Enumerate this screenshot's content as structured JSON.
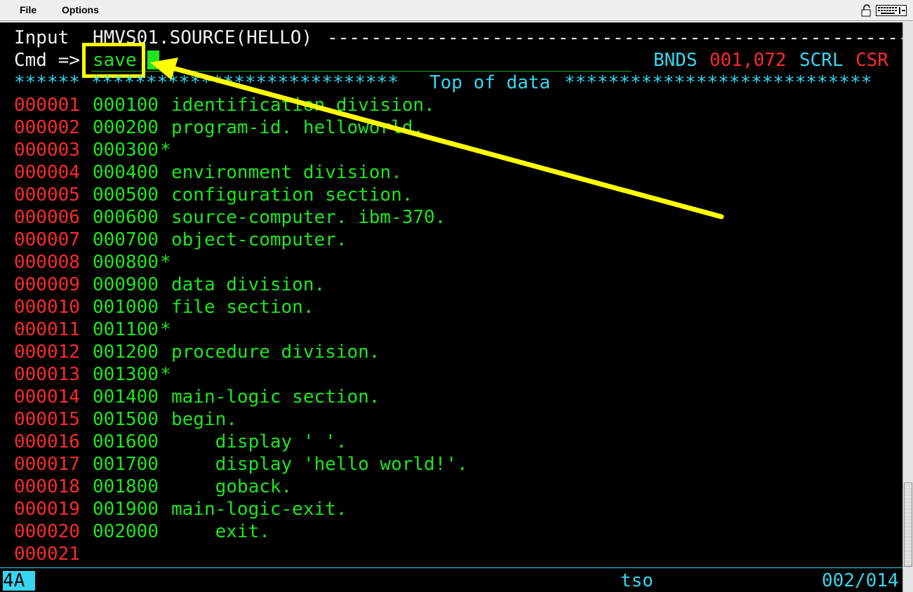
{
  "menubar": {
    "items": [
      {
        "label": "File"
      },
      {
        "label": "Options"
      }
    ],
    "tray_icons": [
      "lock-icon",
      "keyboard-icon"
    ]
  },
  "editor": {
    "header": {
      "mode": "Input",
      "dataset": "HMVS01.SOURCE(HELLO)",
      "rule": "------------------------------------------------------"
    },
    "command": {
      "prompt": "Cmd =>",
      "value": "save",
      "bnds_label": "BNDS",
      "bnds_value": "001,072",
      "scrl_label": "SCRL",
      "scrl_value": "CSR"
    },
    "top_of_data": {
      "left": "****** ****************************",
      "label": "Top of data",
      "right": "****************************"
    },
    "lines": [
      {
        "num": "000001",
        "seq": "000100",
        "text": "identification division."
      },
      {
        "num": "000002",
        "seq": "000200",
        "text": "program-id. helloworld."
      },
      {
        "num": "000003",
        "seq": "000300",
        "text": "*"
      },
      {
        "num": "000004",
        "seq": "000400",
        "text": "environment division."
      },
      {
        "num": "000005",
        "seq": "000500",
        "text": "configuration section."
      },
      {
        "num": "000006",
        "seq": "000600",
        "text": "source-computer. ibm-370."
      },
      {
        "num": "000007",
        "seq": "000700",
        "text": "object-computer."
      },
      {
        "num": "000008",
        "seq": "000800",
        "text": "*"
      },
      {
        "num": "000009",
        "seq": "000900",
        "text": "data division."
      },
      {
        "num": "000010",
        "seq": "001000",
        "text": "file section."
      },
      {
        "num": "000011",
        "seq": "001100",
        "text": "*"
      },
      {
        "num": "000012",
        "seq": "001200",
        "text": "procedure division."
      },
      {
        "num": "000013",
        "seq": "001300",
        "text": "*"
      },
      {
        "num": "000014",
        "seq": "001400",
        "text": "main-logic section."
      },
      {
        "num": "000015",
        "seq": "001500",
        "text": "begin."
      },
      {
        "num": "000016",
        "seq": "001600",
        "text": "    display ' '."
      },
      {
        "num": "000017",
        "seq": "001700",
        "text": "    display 'hello world!'."
      },
      {
        "num": "000018",
        "seq": "001800",
        "text": "    goback."
      },
      {
        "num": "000019",
        "seq": "001900",
        "text": "main-logic-exit."
      },
      {
        "num": "000020",
        "seq": "002000",
        "text": "    exit."
      },
      {
        "num": "000021",
        "seq": "",
        "text": ""
      }
    ]
  },
  "status_bar": {
    "oia": "4A",
    "session": "tso",
    "cursor_pos": "002/014"
  },
  "colors": {
    "screen_bg": "#000000",
    "line_number": "#ff2a2a",
    "code_text": "#1ee61e",
    "info_text": "#37d6f0",
    "header_text": "#f0f0f0",
    "annotation": "#ffff00"
  }
}
